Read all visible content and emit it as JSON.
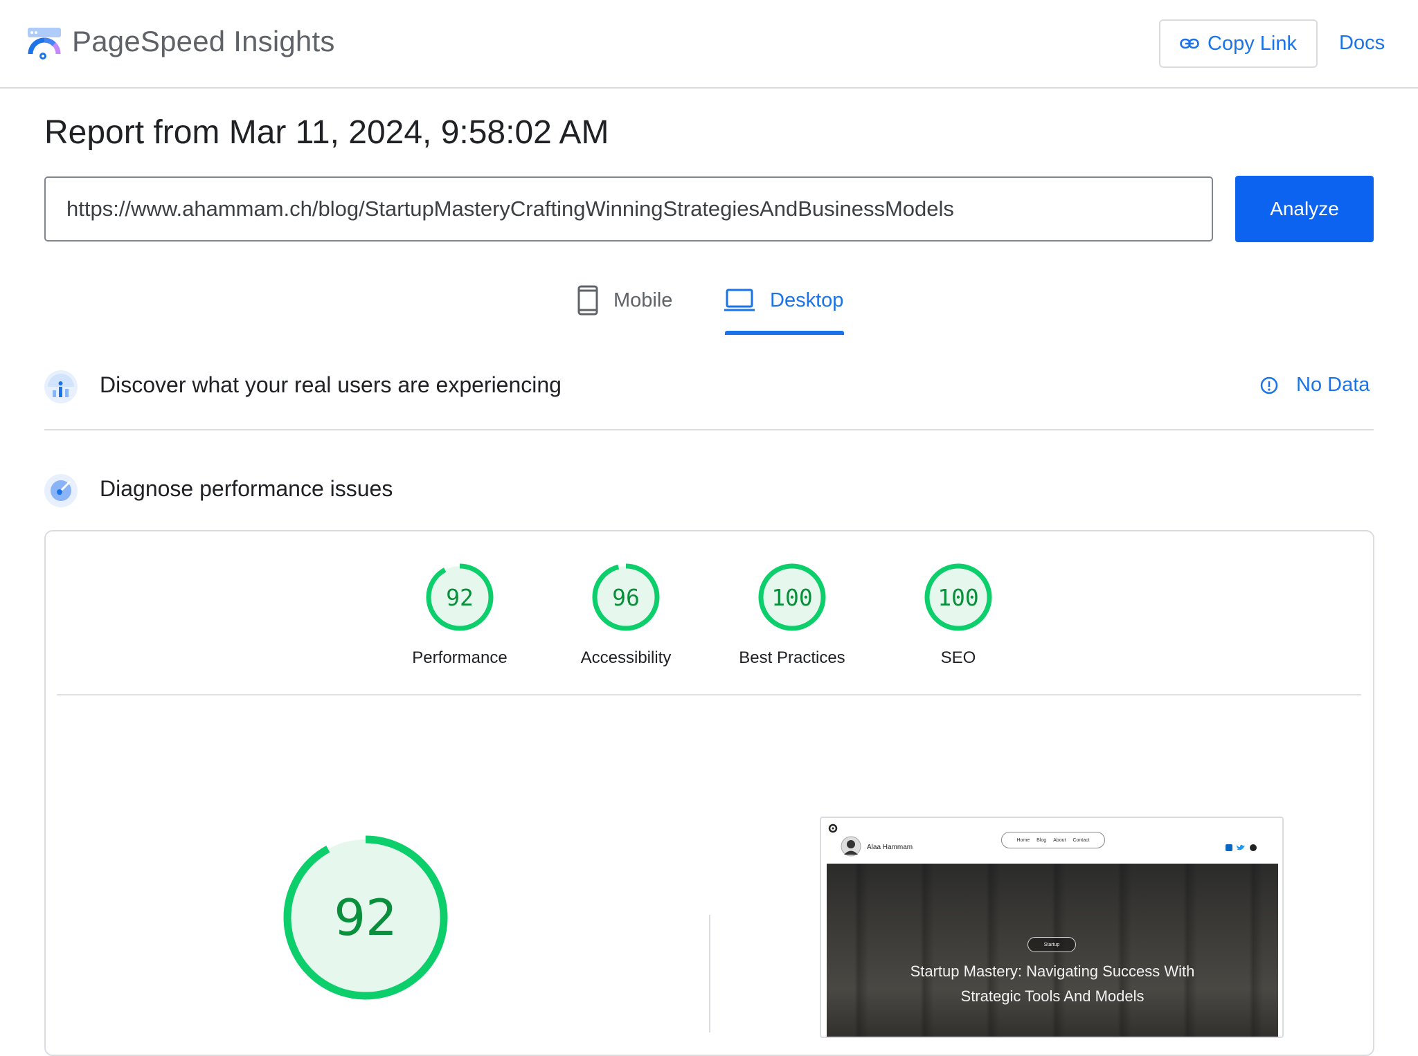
{
  "header": {
    "brand": "PageSpeed Insights",
    "copy_link": "Copy Link",
    "docs": "Docs"
  },
  "report": {
    "title": "Report from Mar 11, 2024, 9:58:02 AM",
    "url": "https://www.ahammam.ch/blog/StartupMasteryCraftingWinningStrategiesAndBusinessModels",
    "analyze": "Analyze"
  },
  "tabs": {
    "mobile": "Mobile",
    "desktop": "Desktop",
    "selected": "Desktop"
  },
  "field_data": {
    "title": "Discover what your real users are experiencing",
    "status": "No Data"
  },
  "diagnose": {
    "title": "Diagnose performance issues",
    "scores": [
      {
        "label": "Performance",
        "value": "92"
      },
      {
        "label": "Accessibility",
        "value": "96"
      },
      {
        "label": "Best Practices",
        "value": "100"
      },
      {
        "label": "SEO",
        "value": "100"
      }
    ],
    "main_score": "92"
  },
  "preview": {
    "author": "Alaa Hammam",
    "nav": [
      "Home",
      "Blog",
      "About",
      "Contact"
    ],
    "tag": "Startup",
    "headline_1": "Startup Mastery: Navigating Success With",
    "headline_2": "Strategic Tools And Models"
  },
  "colors": {
    "accent": "#1a73e8",
    "pass": "#0cce6b",
    "pass_text": "#0a8f3c"
  }
}
